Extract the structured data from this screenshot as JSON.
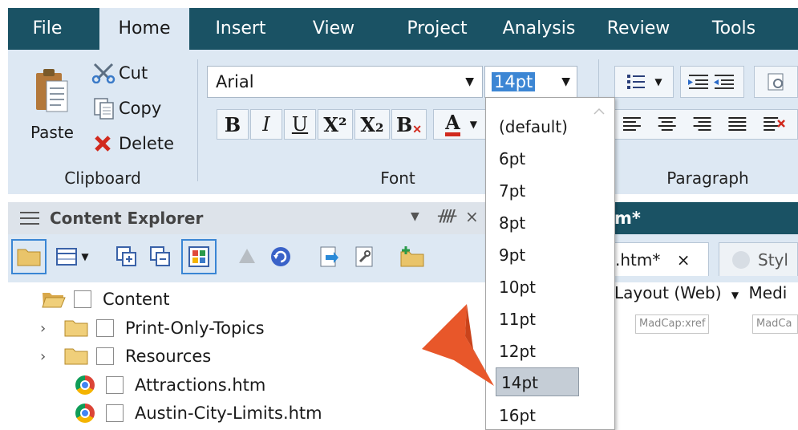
{
  "menubar": {
    "tabs": [
      {
        "label": "File"
      },
      {
        "label": "Home"
      },
      {
        "label": "Insert"
      },
      {
        "label": "View"
      },
      {
        "label": "Project"
      },
      {
        "label": "Analysis"
      },
      {
        "label": "Review"
      },
      {
        "label": "Tools"
      }
    ],
    "active_tab": "Home"
  },
  "ribbon": {
    "clipboard": {
      "paste_label": "Paste",
      "cut_label": "Cut",
      "copy_label": "Copy",
      "delete_label": "Delete",
      "group_label": "Clipboard"
    },
    "font": {
      "font_name": "Arial",
      "font_size": "14pt",
      "group_label": "Font",
      "buttons": [
        "B",
        "I",
        "U",
        "X²",
        "X₂",
        "B"
      ],
      "font_color_label": "A"
    },
    "paragraph": {
      "group_label": "Paragraph"
    }
  },
  "size_dropdown": {
    "options": [
      "(default)",
      "6pt",
      "7pt",
      "8pt",
      "9pt",
      "10pt",
      "11pt",
      "12pt",
      "14pt",
      "16pt"
    ],
    "selected": "14pt"
  },
  "content_explorer": {
    "title": "Content Explorer",
    "tree": [
      {
        "label": "Content",
        "type": "folder-open"
      },
      {
        "label": "Print-Only-Topics",
        "type": "folder"
      },
      {
        "label": "Resources",
        "type": "folder"
      },
      {
        "label": "Attractions.htm",
        "type": "file"
      },
      {
        "label": "Austin-City-Limits.htm",
        "type": "file"
      }
    ]
  },
  "document": {
    "title_fragment": "m*",
    "tab_label": ".htm*",
    "tab_close": "×",
    "style_tab_label": "Styl",
    "layout_label": "Layout (Web)",
    "medium_label": "Medi",
    "xref_label": "MadCap:xref",
    "xref_label_2": "MadCa"
  },
  "colors": {
    "menubar": "#1a5264",
    "ribbon": "#dde8f3",
    "accent_arrow": "#e8572a"
  }
}
